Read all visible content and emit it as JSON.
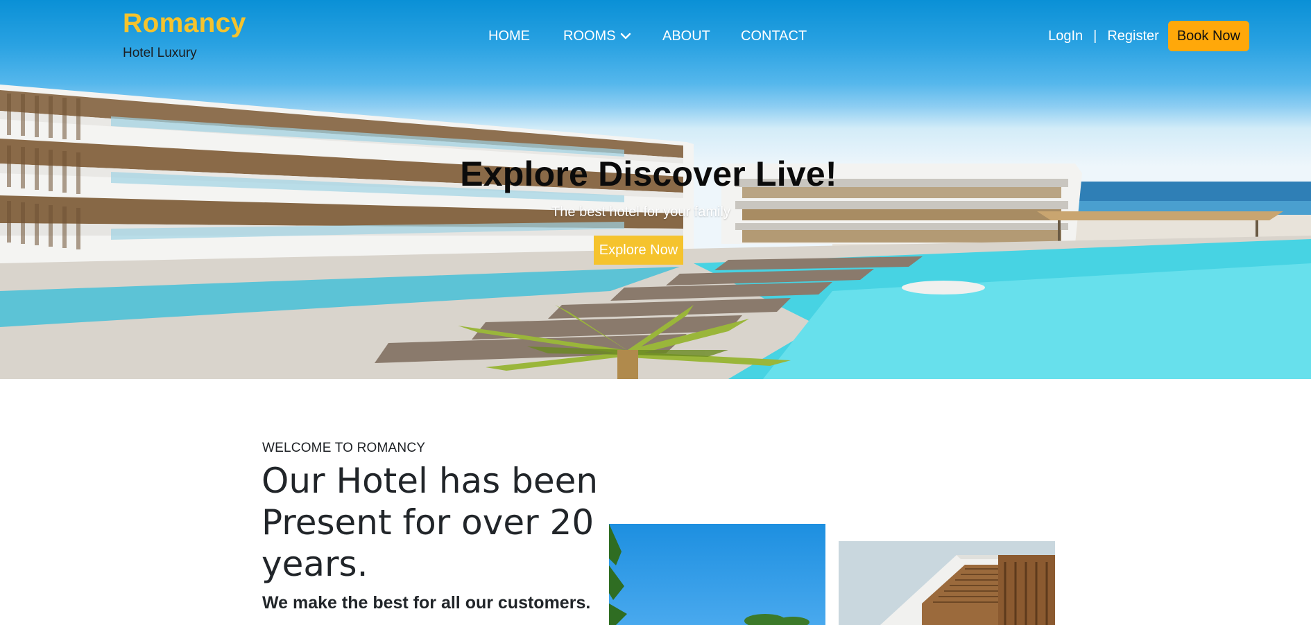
{
  "brand": {
    "name": "Romancy",
    "tagline": "Hotel Luxury"
  },
  "nav": {
    "items": [
      {
        "label": "HOME"
      },
      {
        "label": "ROOMS",
        "icon": "chevron-down-icon"
      },
      {
        "label": "ABOUT"
      },
      {
        "label": "CONTACT"
      }
    ]
  },
  "auth": {
    "login": "LogIn",
    "separator": "|",
    "register": "Register",
    "book": "Book Now"
  },
  "hero": {
    "title": "Explore Discover Live!",
    "subtitle": "The best hotel for your family",
    "cta": "Explore Now"
  },
  "welcome": {
    "kicker": "WELCOME TO ROMANCY",
    "title": "Our Hotel has been Present for over 20 years.",
    "lead": "We make the best for all our customers."
  },
  "colors": {
    "brand_yellow": "#f5c32d",
    "book_orange": "#ffa80a",
    "sky_blue": "#0a90d6",
    "pool_turquoise": "#3fd0e0"
  }
}
